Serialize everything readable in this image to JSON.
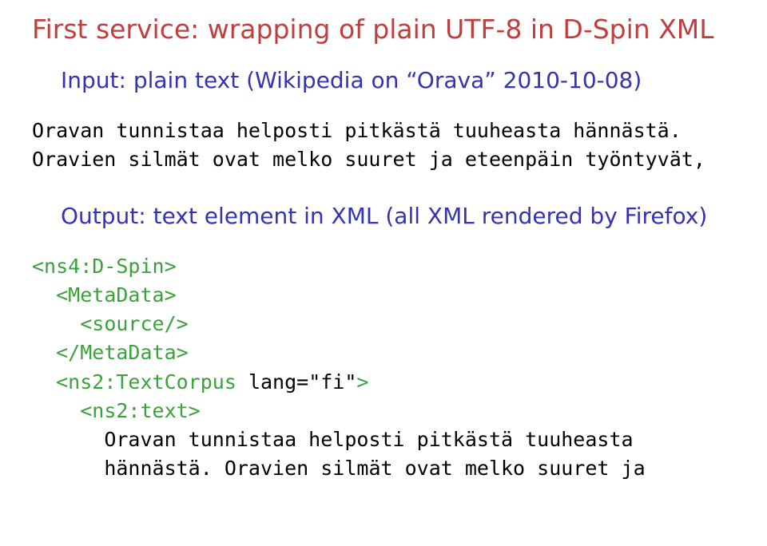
{
  "title": "First service: wrapping of plain UTF-8 in D-Spin XML",
  "input_label": "Input: plain text (Wikipedia on “Orava” 2010-10-08)",
  "input_text": "Oravan tunnistaa helposti pitkästä tuuheasta hännästä.\nOravien silmät ovat melko suuret ja eteenpäin työntyvät,",
  "output_label": "Output: text element in XML (all XML rendered by Firefox)",
  "xml": {
    "l1": "<ns4:D-Spin>",
    "l2": "<MetaData>",
    "l3": "<source/>",
    "l4": "</MetaData>",
    "l5a": "<ns2:TextCorpus ",
    "l5b": "lang=\"fi\"",
    "l5c": ">",
    "l6": "<ns2:text>",
    "l7": "Oravan tunnistaa helposti pitkästä tuuheasta",
    "l8": "hännästä. Oravien silmät ovat melko suuret ja"
  }
}
